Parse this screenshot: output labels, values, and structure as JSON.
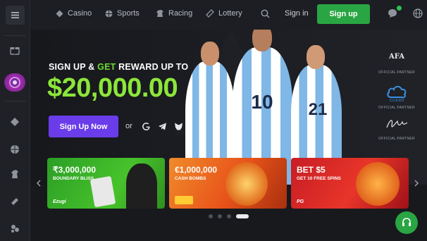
{
  "header": {
    "nav": [
      {
        "label": "Casino",
        "icon": "casino-chip-icon"
      },
      {
        "label": "Sports",
        "icon": "sports-ball-icon"
      },
      {
        "label": "Racing",
        "icon": "horse-icon"
      },
      {
        "label": "Lottery",
        "icon": "lottery-ticket-icon"
      }
    ],
    "sign_in": "Sign in",
    "sign_up": "Sign up"
  },
  "hero": {
    "headline_part1": "SIGN UP & ",
    "headline_get": "GET",
    "headline_part2": " REWARD UP TO",
    "amount": "$20,000.00",
    "cta": "Sign Up Now",
    "or": "or",
    "players": [
      {
        "number": ""
      },
      {
        "number": "10"
      },
      {
        "number": "21"
      }
    ],
    "partners": [
      {
        "logo": "AFA",
        "caption": "OFFICIAL PARTNER"
      },
      {
        "logo": "CLOUD9",
        "caption": "OFFICIAL PARTNER"
      },
      {
        "logo": "signature",
        "caption": "OFFICIAL PARTNER"
      }
    ]
  },
  "promos": [
    {
      "title": "₹3,000,000",
      "subtitle": "BOUNDARY BLISS",
      "brand": "Ezugi",
      "color": "#3cb52a"
    },
    {
      "title": "€1,000,000",
      "subtitle": "CASH BOMBS",
      "brand": "",
      "color": "#e0631c"
    },
    {
      "title": "BET $5",
      "subtitle": "GET 10 FREE SPINS",
      "brand": "PG",
      "color": "#d8242a"
    }
  ],
  "carousel": {
    "count": 4,
    "active": 4
  },
  "colors": {
    "accent_green": "#2aa543",
    "cta_purple": "#6a3cea",
    "amount_green": "#8ce63a"
  }
}
